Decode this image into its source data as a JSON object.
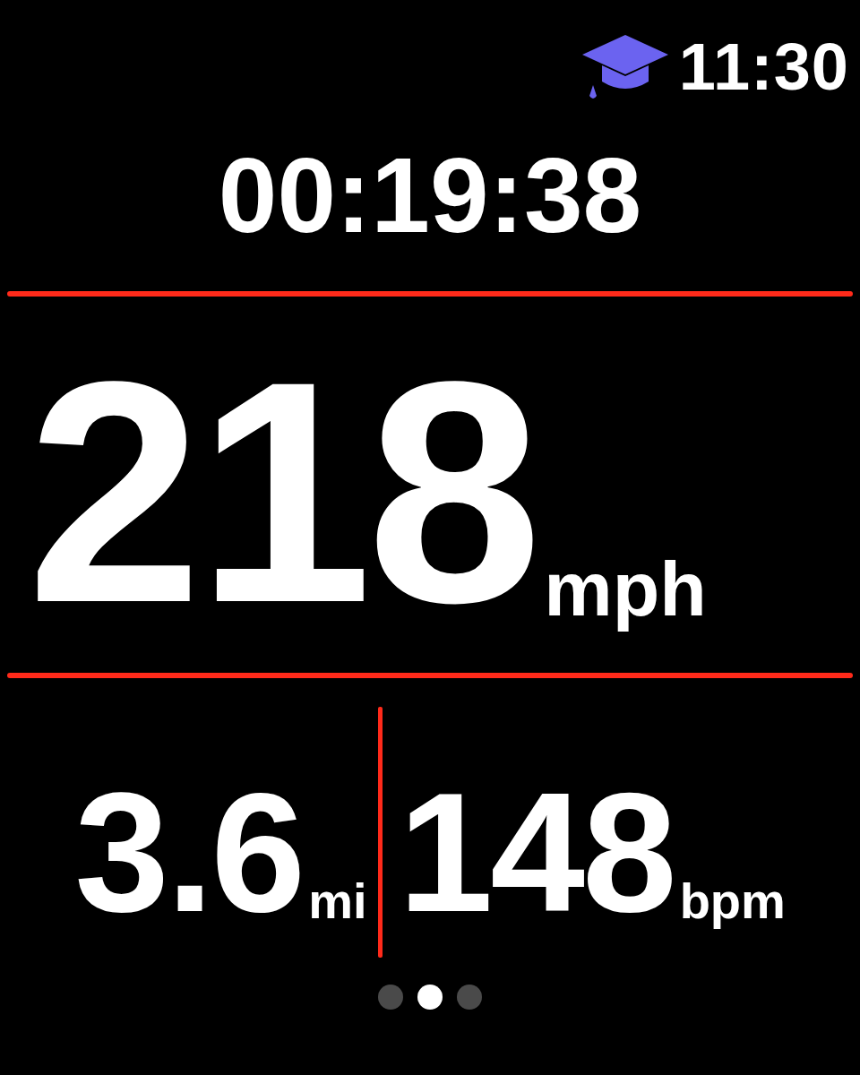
{
  "status_bar": {
    "time": "11:30"
  },
  "elapsed_time": "00:19:38",
  "primary_metric": {
    "value": "218",
    "unit": "mph"
  },
  "secondary_metrics": [
    {
      "value": "3.6",
      "unit": "mi"
    },
    {
      "value": "148",
      "unit": "bpm"
    }
  ],
  "page_indicator": [
    {
      "selected": false
    },
    {
      "selected": true
    },
    {
      "selected": false
    }
  ]
}
